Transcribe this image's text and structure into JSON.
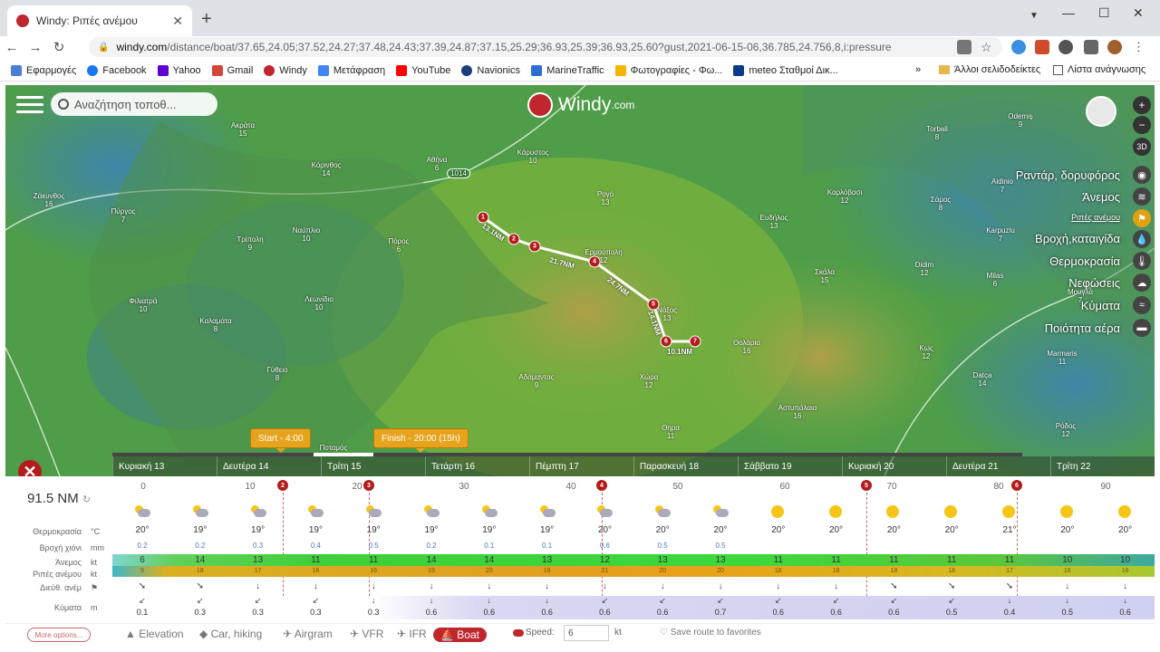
{
  "browser": {
    "tab_title": "Windy: Ριπές ανέμου",
    "url_domain": "windy.com",
    "url_path": "/distance/boat/37.65,24.05;37.52,24.27;37.48,24.43;37.39,24.87;37.15,25.29;36.93,25.39;36.93,25.60?gust,2021-06-15-06,36.785,24.756,8,i:pressure",
    "bookmarks": [
      "Εφαρμογές",
      "Facebook",
      "Yahoo",
      "Gmail",
      "Windy",
      "Μετάφραση",
      "YouTube",
      "Navionics",
      "MarineTraffic",
      "Φωτογραφίες - Φω...",
      "meteo Σταθμοί Δικ..."
    ],
    "bookmarks_more": "»",
    "other_bookmarks": "Άλλοι σελιδοδείκτες",
    "reading_list": "Λίστα ανάγνωσης"
  },
  "map": {
    "search_placeholder": "Αναζήτηση τοποθ...",
    "logo": "Windy",
    "logo_suffix": ".com",
    "btn_3d": "3D",
    "isobar": "1014",
    "layers": [
      {
        "label": "Ραντάρ, δορυφόρος",
        "icon": "radar-icon"
      },
      {
        "label": "Άνεμος",
        "icon": "wind-icon"
      },
      {
        "label": "Ριπές ανέμου",
        "icon": "gust-icon",
        "active": true
      },
      {
        "label": "Βροχή,καταιγίδα",
        "icon": "rain-icon"
      },
      {
        "label": "Θερμοκρασία",
        "icon": "thermometer-icon"
      },
      {
        "label": "Νεφώσεις",
        "icon": "clouds-icon"
      },
      {
        "label": "Κύματα",
        "icon": "waves-icon"
      },
      {
        "label": "Ποιότητα αέρα",
        "icon": "air-quality-icon"
      }
    ],
    "places": [
      {
        "n": "Ζάκυνθος",
        "v": "16"
      },
      {
        "n": "Πύργος",
        "v": "7"
      },
      {
        "n": "Ακράτα",
        "v": "15"
      },
      {
        "n": "Κόρινθος",
        "v": "14"
      },
      {
        "n": "Αθήνα",
        "v": "6"
      },
      {
        "n": "Τρίπολη",
        "v": "9"
      },
      {
        "n": "Ναύπλιο",
        "v": "10"
      },
      {
        "n": "Πόρος",
        "v": "6"
      },
      {
        "n": "Φιλιατρά",
        "v": "10"
      },
      {
        "n": "Καλαμάτα",
        "v": "8"
      },
      {
        "n": "Λεωνίδιο",
        "v": "10"
      },
      {
        "n": "Γύθειο",
        "v": "8"
      },
      {
        "n": "Κάρυστος",
        "v": "10"
      },
      {
        "n": "Ρογό",
        "v": "13"
      },
      {
        "n": "Ερμούπολη",
        "v": "12"
      },
      {
        "n": "Νάξος",
        "v": "13"
      },
      {
        "n": "Αδάμαντας",
        "v": "9"
      },
      {
        "n": "Χώρα",
        "v": "12"
      },
      {
        "n": "Θηρα",
        "v": "11"
      },
      {
        "n": "Θολάρια",
        "v": "16"
      },
      {
        "n": "Αστυπάλαια",
        "v": "16"
      },
      {
        "n": "Ευδήλος",
        "v": "13"
      },
      {
        "n": "Καρλόβασι",
        "v": "12"
      },
      {
        "n": "Σκάλα",
        "v": "15"
      },
      {
        "n": "Κως",
        "v": "12"
      },
      {
        "n": "Datça",
        "v": "14"
      },
      {
        "n": "Ρόδος",
        "v": "12"
      },
      {
        "n": "Σάμος",
        "v": "8"
      },
      {
        "n": "Didim",
        "v": "12"
      },
      {
        "n": "Milas",
        "v": "6"
      },
      {
        "n": "Aidinio",
        "v": "7"
      },
      {
        "n": "Karpuzlu",
        "v": "7"
      },
      {
        "n": "Torbali",
        "v": "8"
      },
      {
        "n": "Odemiş",
        "v": "9"
      },
      {
        "n": "Marmaris",
        "v": "11"
      },
      {
        "n": "Μουγλά",
        "v": "7"
      }
    ],
    "route_segments": [
      "13.1NM",
      "21.7NM",
      "24.7NM",
      "14.1NM",
      "10.1NM"
    ],
    "start_label": "Start - 4:00",
    "finish_label": "Finish - 20:00 (15h)",
    "timeline_place": "Ποταμός",
    "days": [
      "Κυριακή 13",
      "Δευτέρα 14",
      "Τρίτη 15",
      "Τετάρτη 16",
      "Πέμπτη 17",
      "Παρασκευή 18",
      "Σάββατο 19",
      "Κυριακή 20",
      "Δευτέρα 21",
      "Τρίτη 22"
    ]
  },
  "panel": {
    "distance": "91.5 NM",
    "row_labels": [
      {
        "l": "Θερμοκρασία",
        "u": "°C"
      },
      {
        "l": "Βροχή χιόνι",
        "u": "mm"
      },
      {
        "l": "Άνεμος",
        "u": "kt"
      },
      {
        "l": "Ριπές ανέμου",
        "u": "kt"
      },
      {
        "l": "Διεύθ. ανέμ",
        "u": "⚑"
      },
      {
        "l": "Κύματα",
        "u": "m"
      }
    ],
    "scale": [
      "0",
      "10",
      "20",
      "30",
      "40",
      "50",
      "60",
      "70",
      "80",
      "90"
    ],
    "temps": [
      "20°",
      "19°",
      "19°",
      "19°",
      "19°",
      "19°",
      "19°",
      "19°",
      "20°",
      "20°",
      "20°",
      "20°",
      "20°",
      "20°",
      "20°",
      "21°",
      "20°",
      "20°"
    ],
    "rain": [
      "0.2",
      "0.2",
      "0.3",
      "0.4",
      "0.5",
      "0.2",
      "0.1",
      "0.1",
      "0.6",
      "0.5",
      "0.5",
      "",
      "",
      "",
      "",
      "",
      "",
      ""
    ],
    "wind": [
      "6",
      "14",
      "13",
      "11",
      "11",
      "14",
      "14",
      "13",
      "12",
      "13",
      "13",
      "11",
      "11",
      "11",
      "11",
      "11",
      "10",
      "10"
    ],
    "gusts": [
      "9",
      "18",
      "17",
      "16",
      "16",
      "19",
      "20",
      "19",
      "21",
      "20",
      "20",
      "18",
      "18",
      "18",
      "18",
      "17",
      "16",
      "16"
    ],
    "waves": [
      "0.1",
      "0.3",
      "0.3",
      "0.3",
      "0.3",
      "0.6",
      "0.6",
      "0.6",
      "0.6",
      "0.6",
      "0.7",
      "0.6",
      "0.6",
      "0.6",
      "0.5",
      "0.4",
      "0.5",
      "0.6"
    ],
    "icons": [
      "cloud",
      "rain",
      "rain",
      "rain",
      "rain",
      "rain",
      "cloud",
      "cloud",
      "rain",
      "cloud",
      "cloud",
      "sun",
      "sun",
      "sun",
      "sun",
      "sun",
      "sun",
      "sun"
    ]
  },
  "bottom": {
    "more_options": "More options...",
    "modes": [
      "Elevation",
      "Car, hiking",
      "Airgram",
      "VFR",
      "IFR",
      "Boat"
    ],
    "speed_label": "Speed:",
    "speed_value": "6",
    "speed_unit": "kt",
    "save_route": "Save route to favorites"
  }
}
